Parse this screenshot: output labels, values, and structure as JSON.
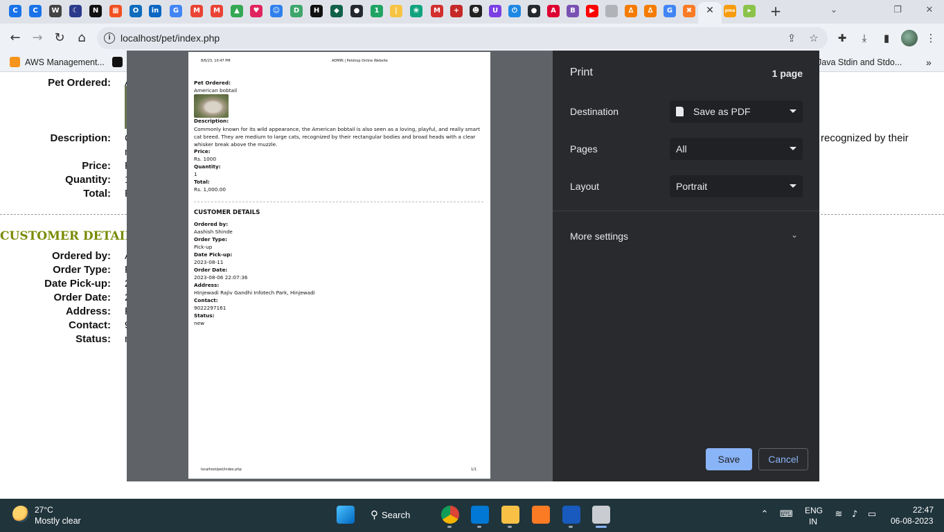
{
  "browser": {
    "tabs": [
      {
        "icon": "chrome-c-icon",
        "color": "#1a73e8",
        "glyph": "C"
      },
      {
        "icon": "chrome-c-icon",
        "color": "#1a73e8",
        "glyph": "C"
      },
      {
        "icon": "wordpress-icon",
        "color": "#444444",
        "glyph": "W"
      },
      {
        "icon": "moon-app-icon",
        "color": "#2b3a8a",
        "glyph": "☾"
      },
      {
        "icon": "notion-icon",
        "color": "#111111",
        "glyph": "N"
      },
      {
        "icon": "microsoft-icon",
        "color": "#f25022",
        "glyph": "▦"
      },
      {
        "icon": "outlook-icon",
        "color": "#0f6cbd",
        "glyph": "O"
      },
      {
        "icon": "linkedin-icon",
        "color": "#0a66c2",
        "glyph": "in"
      },
      {
        "icon": "translate-icon",
        "color": "#4285f4",
        "glyph": "G"
      },
      {
        "icon": "gmail-icon",
        "color": "#ea4335",
        "glyph": "M"
      },
      {
        "icon": "gmail-icon",
        "color": "#ea4335",
        "glyph": "M"
      },
      {
        "icon": "google-drive-icon",
        "color": "#34a853",
        "glyph": "▲"
      },
      {
        "icon": "heart-app-icon",
        "color": "#e0245e",
        "glyph": "♥"
      },
      {
        "icon": "bot-icon",
        "color": "#2f80ed",
        "glyph": "☺"
      },
      {
        "icon": "d-app-icon",
        "color": "#3ea66b",
        "glyph": "D"
      },
      {
        "icon": "hackerrank-icon",
        "color": "#111111",
        "glyph": "H"
      },
      {
        "icon": "mongodb-icon",
        "color": "#116149",
        "glyph": "◆"
      },
      {
        "icon": "github-icon",
        "color": "#24292f",
        "glyph": "●"
      },
      {
        "icon": "one-app-icon",
        "color": "#1fa463",
        "glyph": "1"
      },
      {
        "icon": "bar-app-icon",
        "color": "#f6c343",
        "glyph": "|"
      },
      {
        "icon": "openai-icon",
        "color": "#10a37f",
        "glyph": "❀"
      },
      {
        "icon": "m-red-icon",
        "color": "#d32f2f",
        "glyph": "M"
      },
      {
        "icon": "cross-app-icon",
        "color": "#c62828",
        "glyph": "+"
      },
      {
        "icon": "profile-app-icon",
        "color": "#222222",
        "glyph": "☻"
      },
      {
        "icon": "u-app-icon",
        "color": "#7b3fe4",
        "glyph": "U"
      },
      {
        "icon": "power-app-icon",
        "color": "#1e88e5",
        "glyph": "⏻"
      },
      {
        "icon": "github-icon",
        "color": "#24292f",
        "glyph": "●"
      },
      {
        "icon": "angular-icon",
        "color": "#dd0031",
        "glyph": "A"
      },
      {
        "icon": "bootstrap-icon",
        "color": "#7952b3",
        "glyph": "B"
      },
      {
        "icon": "youtube-icon",
        "color": "#ff0000",
        "glyph": "▶"
      },
      {
        "icon": "grey-circle-icon",
        "color": "#b0b4b8",
        "glyph": ""
      },
      {
        "icon": "xampp-triangle-icon",
        "color": "#f57c00",
        "glyph": "∆"
      },
      {
        "icon": "xampp-triangle-icon",
        "color": "#f57c00",
        "glyph": "∆"
      },
      {
        "icon": "google-icon",
        "color": "#4285f4",
        "glyph": "G"
      },
      {
        "icon": "xampp-icon",
        "color": "#fb7a24",
        "glyph": "✖"
      },
      {
        "icon": "phpmyadmin-icon",
        "color": "#f89c0e",
        "glyph": "pma"
      },
      {
        "icon": "green-app-icon",
        "color": "#8bc34a",
        "glyph": "▸"
      }
    ],
    "url": "localhost/pet/index.php",
    "bookmarks": {
      "aws": "AWS Management...",
      "java": "Java Stdin and Stdo..."
    },
    "window_controls": {
      "minimize": "⌄",
      "restore": "❐",
      "close": "✕"
    }
  },
  "page": {
    "labels": {
      "pet_ordered": "Pet Ordered:",
      "description": "Description:",
      "price": "Price:",
      "quantity": "Quantity:",
      "total": "Total:",
      "ordered_by": "Ordered by:",
      "order_type": "Order Type:",
      "date_pickup": "Date Pick-up:",
      "order_date": "Order Date:",
      "address": "Address:",
      "contact": "Contact:",
      "status": "Status:"
    },
    "value_fragments": {
      "pet_ordered": "A",
      "description": "C",
      "description_second": "n",
      "price": "F",
      "quantity": "1",
      "total": "F",
      "ordered_by": "A",
      "order_type": "F",
      "date_pickup": "2",
      "order_date": "2",
      "address": "F",
      "contact": "9",
      "status": "n"
    },
    "description_tail": "recognized by their",
    "customer_details_title": "CUSTOMER DETAILS"
  },
  "preview": {
    "header_date": "8/6/23, 10:47 PM",
    "header_title": "ADMIN | Petshop Online Website",
    "pet_ordered_label": "Pet Ordered:",
    "pet_ordered_value": "American bobtail",
    "description_label": "Description:",
    "description_value": "Commonly known for its wild appearance, the American bobtail is also seen as a loving, playful, and really smart cat breed. They are medium to large cats, recognized by their rectangular bodies and broad heads with a clear whisker break above the muzzle.",
    "price_label": "Price:",
    "price_value": "Rs. 1000",
    "quantity_label": "Quantity:",
    "quantity_value": "1",
    "total_label": "Total:",
    "total_value": "Rs. 1,000.00",
    "customer_details_title": "CUSTOMER DETAILS",
    "ordered_by_label": "Ordered by:",
    "ordered_by_value": "Aashish Shinde",
    "order_type_label": "Order Type:",
    "order_type_value": "Pick-up",
    "date_pickup_label": "Date Pick-up:",
    "date_pickup_value": "2023-08-11",
    "order_date_label": "Order Date:",
    "order_date_value": "2023-08-06 22:07:36",
    "address_label": "Address:",
    "address_value": "Hinjewadi Rajiv Gandhi Infotech Park, Hinjewadi",
    "contact_label": "Contact:",
    "contact_value": "9022297161",
    "status_label": "Status:",
    "status_value": "new",
    "footer_url": "localhost/pet/index.php",
    "footer_page": "1/1"
  },
  "print_dialog": {
    "title": "Print",
    "page_count": "1 page",
    "destination_label": "Destination",
    "destination_value": "Save as PDF",
    "pages_label": "Pages",
    "pages_value": "All",
    "layout_label": "Layout",
    "layout_value": "Portrait",
    "more_settings": "More settings",
    "save_button": "Save",
    "cancel_button": "Cancel"
  },
  "taskbar": {
    "temperature": "27°C",
    "weather": "Mostly clear",
    "search": "Search",
    "language": "ENG",
    "region": "IN",
    "time": "22:47",
    "date": "06-08-2023"
  }
}
